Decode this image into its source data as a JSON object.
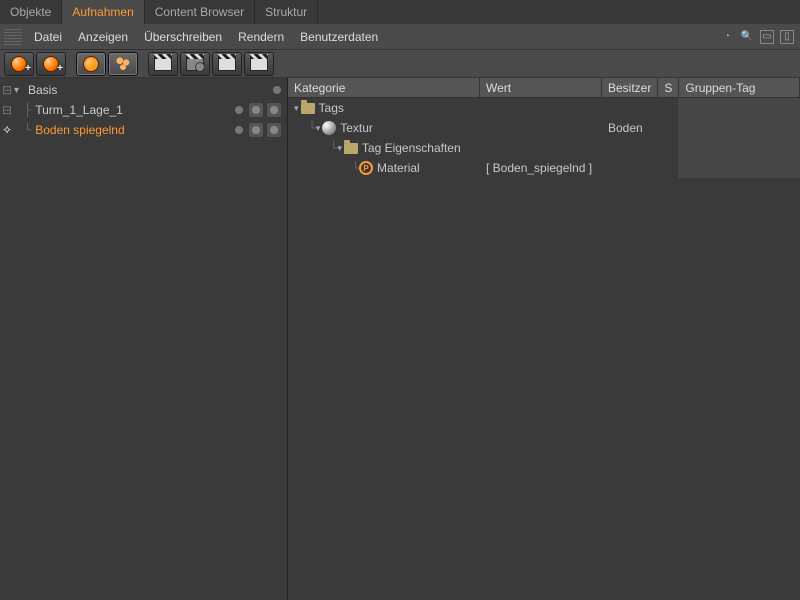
{
  "tabs": [
    "Objekte",
    "Aufnahmen",
    "Content Browser",
    "Struktur"
  ],
  "active_tab": 1,
  "menu": [
    "Datei",
    "Anzeigen",
    "Überschreiben",
    "Rendern",
    "Benutzerdaten"
  ],
  "toolbar_icons": [
    "take-add-1",
    "take-add-2",
    "take-link",
    "take-sphere",
    "take-blobs",
    "clap-1",
    "clap-gear",
    "clap-2",
    "clap-3"
  ],
  "hierarchy": [
    {
      "name": "Basis",
      "level": 0,
      "selected": false,
      "has_tags": false,
      "cross": "dash"
    },
    {
      "name": "Turm_1_Lage_1",
      "level": 1,
      "selected": false,
      "has_tags": true,
      "cross": "dash"
    },
    {
      "name": "Boden spiegelnd",
      "level": 1,
      "selected": true,
      "has_tags": true,
      "cross": "cross"
    }
  ],
  "columns": {
    "kategorie": "Kategorie",
    "wert": "Wert",
    "besitzer": "Besitzer",
    "s": "S",
    "gruppentag": "Gruppen-Tag"
  },
  "rows": [
    {
      "indent": 0,
      "icon": "folder",
      "label": "Tags",
      "wert": "",
      "besitzer": ""
    },
    {
      "indent": 1,
      "icon": "sphere",
      "label": "Textur",
      "wert": "",
      "besitzer": "Boden"
    },
    {
      "indent": 2,
      "icon": "folder",
      "label": "Tag Eigenschaften",
      "wert": "",
      "besitzer": ""
    },
    {
      "indent": 3,
      "icon": "p",
      "label": "Material",
      "wert": "[ Boden_spiegelnd ]",
      "besitzer": ""
    }
  ]
}
